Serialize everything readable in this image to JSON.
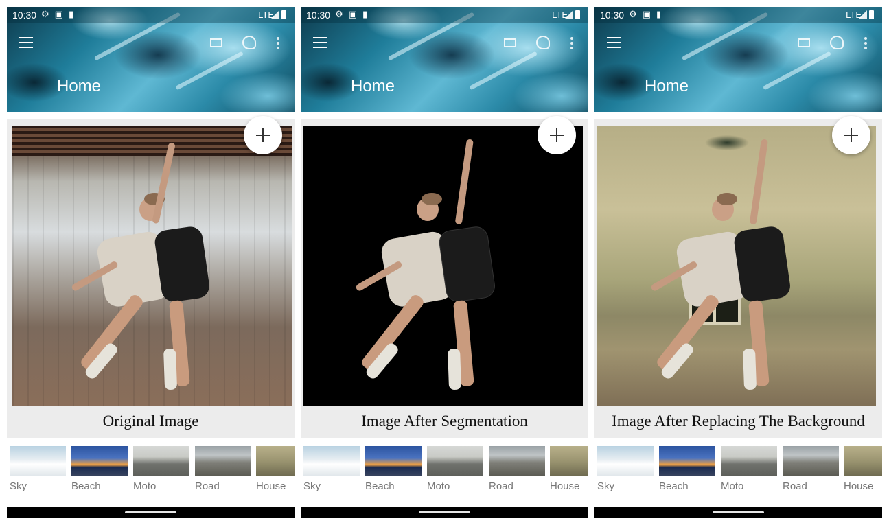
{
  "colors": {
    "accent_header": "#1f7d9a",
    "card_bg": "#ececec",
    "fab_bg": "#ffffff",
    "navbar": "#000000"
  },
  "screens": [
    {
      "status": {
        "time": "10:30",
        "network": "LTE"
      },
      "toolbar": {
        "title": "Home",
        "icons": [
          "menu-icon",
          "mail-icon",
          "palette-icon",
          "more-vert-icon"
        ]
      },
      "image_kind": "original",
      "caption": "Original Image",
      "thumbnails": [
        {
          "label": "Sky",
          "icon": "sky-thumbnail"
        },
        {
          "label": "Beach",
          "icon": "beach-thumbnail"
        },
        {
          "label": "Moto",
          "icon": "moto-thumbnail"
        },
        {
          "label": "Road",
          "icon": "road-thumbnail"
        },
        {
          "label": "House",
          "icon": "house-thumbnail"
        }
      ]
    },
    {
      "status": {
        "time": "10:30",
        "network": "LTE"
      },
      "toolbar": {
        "title": "Home",
        "icons": [
          "menu-icon",
          "mail-icon",
          "palette-icon",
          "more-vert-icon"
        ]
      },
      "image_kind": "segmented",
      "caption": "Image After Segmentation",
      "thumbnails": [
        {
          "label": "Sky",
          "icon": "sky-thumbnail"
        },
        {
          "label": "Beach",
          "icon": "beach-thumbnail"
        },
        {
          "label": "Moto",
          "icon": "moto-thumbnail"
        },
        {
          "label": "Road",
          "icon": "road-thumbnail"
        },
        {
          "label": "House",
          "icon": "house-thumbnail"
        }
      ]
    },
    {
      "status": {
        "time": "10:30",
        "network": "LTE"
      },
      "toolbar": {
        "title": "Home",
        "icons": [
          "menu-icon",
          "mail-icon",
          "palette-icon",
          "more-vert-icon"
        ]
      },
      "image_kind": "replaced",
      "caption": "Image After Replacing The Background",
      "thumbnails": [
        {
          "label": "Sky",
          "icon": "sky-thumbnail"
        },
        {
          "label": "Beach",
          "icon": "beach-thumbnail"
        },
        {
          "label": "Moto",
          "icon": "moto-thumbnail"
        },
        {
          "label": "Road",
          "icon": "road-thumbnail"
        },
        {
          "label": "House",
          "icon": "house-thumbnail"
        }
      ]
    }
  ]
}
